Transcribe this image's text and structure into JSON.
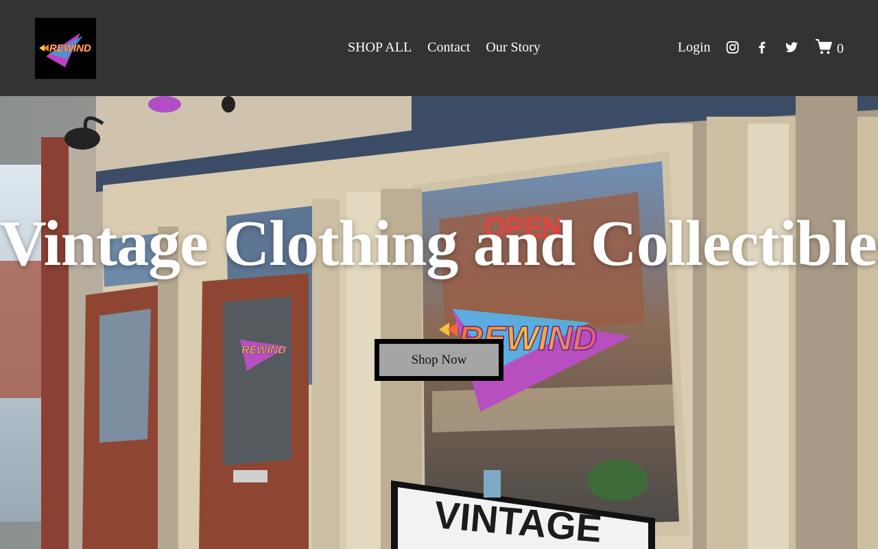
{
  "header": {
    "logo_text": "REWIND",
    "nav": [
      {
        "label": "SHOP ALL"
      },
      {
        "label": "Contact"
      },
      {
        "label": "Our Story"
      }
    ],
    "login_label": "Login",
    "social": [
      {
        "icon": "instagram-icon"
      },
      {
        "icon": "facebook-icon"
      },
      {
        "icon": "twitter-icon"
      }
    ],
    "cart_icon": "cart-icon",
    "cart_count": "0"
  },
  "hero": {
    "title": "Vintage Clothing and Collectibles",
    "cta_label": "Shop Now",
    "sign_open": "OPEN",
    "sign_rewind": "REWIND",
    "sign_vintage": "VINTAGE"
  },
  "colors": {
    "header_bg": "#333333",
    "button_bg": "#a5a5a5",
    "button_border": "#000000"
  }
}
